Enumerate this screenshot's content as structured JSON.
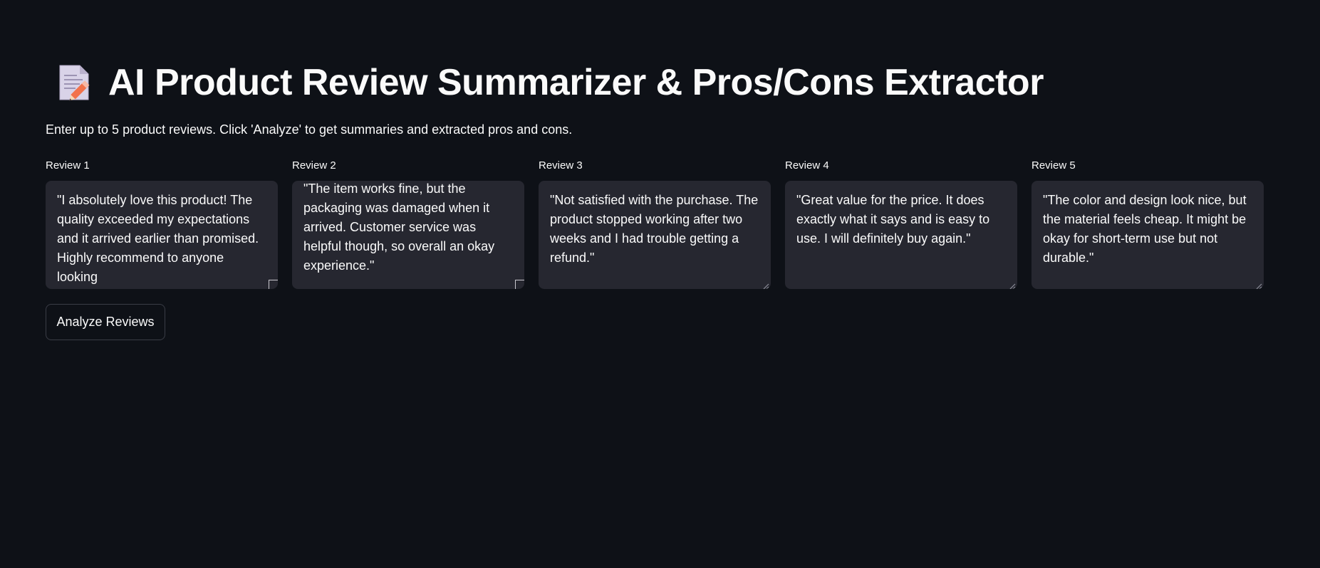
{
  "header": {
    "title": "AI Product Review Summarizer & Pros/Cons Extractor",
    "title_icon": "memo-icon",
    "subtitle": "Enter up to 5 product reviews. Click 'Analyze' to get summaries and extracted pros and cons."
  },
  "reviews": [
    {
      "label": "Review 1",
      "value": "\"I absolutely love this product! The quality exceeded my expectations and it arrived earlier than promised. Highly recommend to anyone looking"
    },
    {
      "label": "Review 2",
      "value": "\"The item works fine, but the packaging was damaged when it arrived. Customer service was helpful though, so overall an okay experience.\""
    },
    {
      "label": "Review 3",
      "value": "\"Not satisfied with the purchase. The product stopped working after two weeks and I had trouble getting a refund.\""
    },
    {
      "label": "Review 4",
      "value": "\"Great value for the price. It does exactly what it says and is easy to use. I will definitely buy again.\""
    },
    {
      "label": "Review 5",
      "value": "\"The color and design look nice, but the material feels cheap. It might be okay for short-term use but not durable.\""
    }
  ],
  "actions": {
    "analyze_label": "Analyze Reviews"
  },
  "colors": {
    "background": "#0e1117",
    "text": "#fafafa",
    "input_background": "#262730",
    "button_border": "#3a3d46"
  }
}
